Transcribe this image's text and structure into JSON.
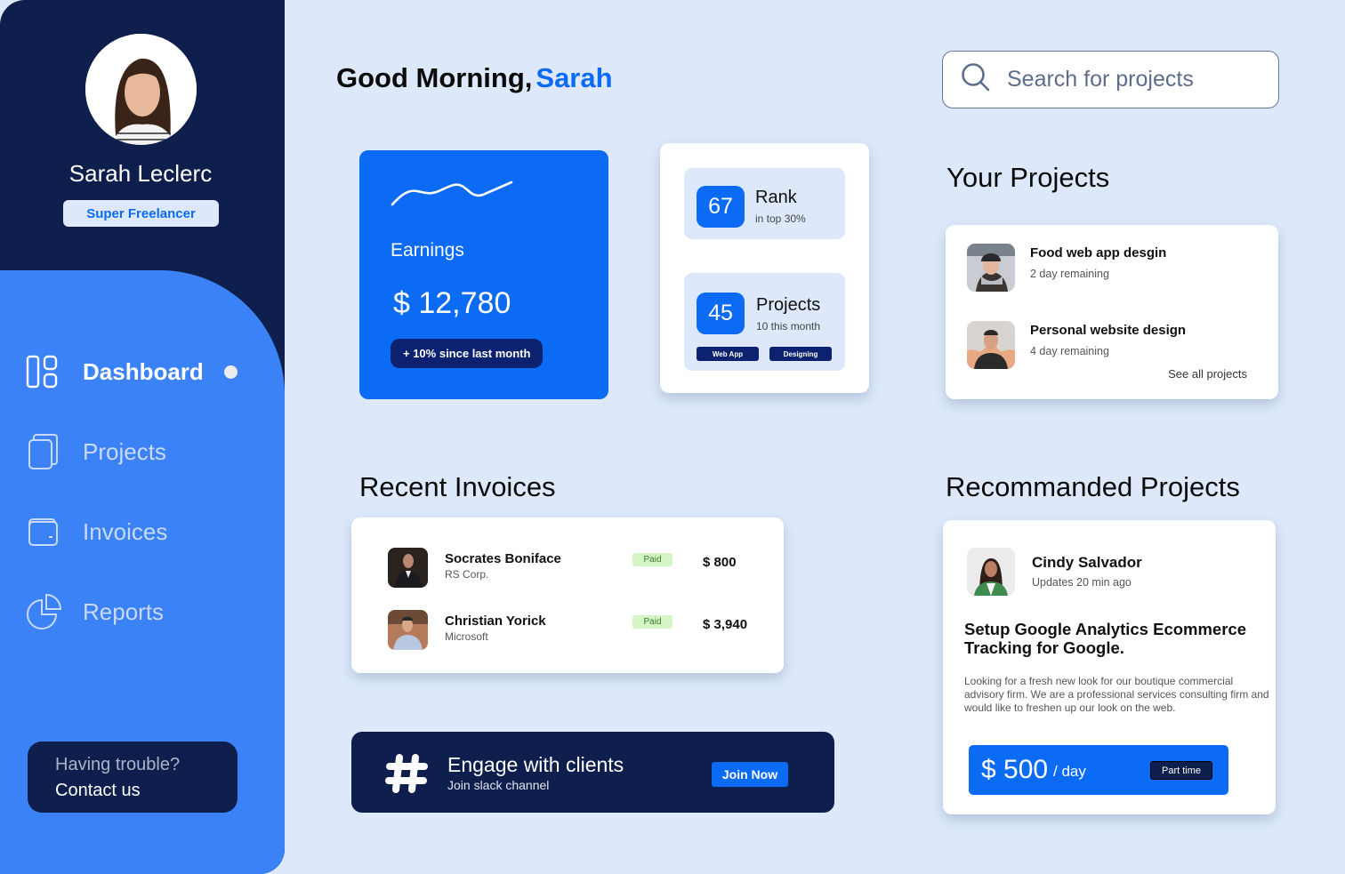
{
  "profile": {
    "name": "Sarah Leclerc",
    "badge": "Super Freelancer"
  },
  "sidebar": {
    "items": [
      {
        "label": "Dashboard",
        "icon": "dashboard-icon",
        "active": true
      },
      {
        "label": "Projects",
        "icon": "projects-icon",
        "active": false
      },
      {
        "label": "Invoices",
        "icon": "wallet-icon",
        "active": false
      },
      {
        "label": "Reports",
        "icon": "pie-chart-icon",
        "active": false
      }
    ],
    "help": {
      "question": "Having trouble?",
      "action": "Contact us"
    }
  },
  "header": {
    "greeting": "Good Morning,",
    "user": "Sarah",
    "search_placeholder": "Search for projects"
  },
  "earnings": {
    "label": "Earnings",
    "amount": "$ 12,780",
    "change": "+ 10% since last month"
  },
  "stats": {
    "rank": {
      "value": "67",
      "title": "Rank",
      "subtitle": "in top 30%"
    },
    "projects": {
      "value": "45",
      "title": "Projects",
      "subtitle": "10 this month",
      "tags": [
        "Web App",
        "Designing"
      ]
    }
  },
  "your_projects": {
    "title": "Your Projects",
    "items": [
      {
        "name": "Food web app desgin",
        "remaining": "2 day remaining"
      },
      {
        "name": "Personal website design",
        "remaining": "4 day remaining"
      }
    ],
    "see_all": "See all projects"
  },
  "invoices": {
    "title": "Recent Invoices",
    "rows": [
      {
        "name": "Socrates Boniface",
        "company": "RS Corp.",
        "status": "Paid",
        "amount": "$ 800"
      },
      {
        "name": "Christian Yorick",
        "company": "Microsoft",
        "status": "Paid",
        "amount": "$ 3,940"
      }
    ]
  },
  "engage": {
    "title": "Engage with clients",
    "subtitle": "Join slack channel",
    "button": "Join Now"
  },
  "recommended": {
    "title": "Recommanded Projects",
    "client": "Cindy Salvador",
    "updated": "Updates 20 min ago",
    "project_title": "Setup Google Analytics Ecommerce Tracking for Google.",
    "description": "Looking for a fresh new look for our boutique commercial advisory firm. We are a professional services consulting firm and would like to freshen up our look on the web.",
    "rate": "$ 500",
    "rate_unit": "/ day",
    "type": "Part time"
  },
  "colors": {
    "accent": "#0b6bf5",
    "navy": "#0f1f4d",
    "sidebar_blue": "#3b82f6",
    "background": "#dde9fb",
    "paid_bg": "#d6f5c6"
  }
}
